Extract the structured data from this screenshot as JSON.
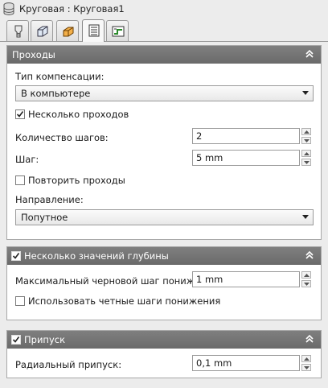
{
  "window": {
    "title": "Круговая : Круговая1"
  },
  "tabs": [
    {
      "icon": "tool-icon"
    },
    {
      "icon": "stock-box-icon"
    },
    {
      "icon": "geometry-icon"
    },
    {
      "icon": "passes-icon",
      "active": true
    },
    {
      "icon": "linking-icon"
    }
  ],
  "passes": {
    "header": "Проходы",
    "compensation_label": "Тип компенсации:",
    "compensation_value": "В компьютере",
    "multiple_passes_label": "Несколько проходов",
    "multiple_passes_checked": true,
    "step_count_label": "Количество шагов:",
    "step_count_value": "2",
    "step_label": "Шаг:",
    "step_value": "5 mm",
    "repeat_label": "Повторить проходы",
    "repeat_checked": false,
    "direction_label": "Направление:",
    "direction_value": "Попутное"
  },
  "depth": {
    "header": "Несколько значений глубины",
    "checked": true,
    "max_step_label": "Максимальный черновой шаг понижения:",
    "max_step_value": "1 mm",
    "even_steps_label": "Использовать четные шаги понижения",
    "even_steps_checked": false
  },
  "stock": {
    "header": "Припуск",
    "checked": true,
    "radial_label": "Радиальный припуск:",
    "radial_value": "0,1 mm"
  }
}
